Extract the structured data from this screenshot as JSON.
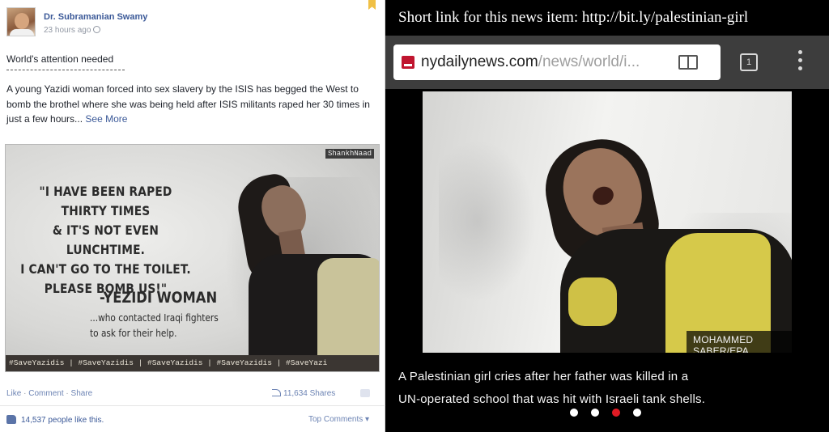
{
  "facebook_post": {
    "author": "Dr. Subramanian Swamy",
    "timestamp": "23 hours ago",
    "title": "World's attention needed",
    "body": "A young Yazidi woman forced into sex slavery by the ISIS has begged the West to bomb the brothel where she was being held after ISIS militants raped her 30 times in just a few hours...",
    "see_more": "See More",
    "poster": {
      "brand": "ShankhNaad",
      "quote_lines": [
        "\"I HAVE BEEN RAPED",
        "THIRTY TIMES",
        "& IT'S NOT EVEN LUNCHTIME.",
        "I CAN'T GO TO THE TOILET.",
        "PLEASE BOMB US!\""
      ],
      "attribution": "-YEZIDI WOMAN",
      "sub_lines": [
        "...who contacted Iraqi fighters",
        "to ask for their help."
      ],
      "hashtag_bar": "#SaveYazidis | #SaveYazidis | #SaveYazidis | #SaveYazidis | #SaveYazi"
    },
    "actions": {
      "like": "Like",
      "comment": "Comment",
      "share": "Share",
      "separator": "·"
    },
    "shares": "11,634 Shares",
    "likes": "14,537 people like this.",
    "top_comments": "Top Comments ▾",
    "icons": {
      "globe": "globe-icon",
      "bookmark": "bookmark-icon",
      "share": "share-icon",
      "comment": "comment-icon",
      "like": "thumbs-up-icon"
    },
    "colors": {
      "link": "#3b5998",
      "muted": "#9197a3"
    }
  },
  "nydailynews": {
    "short_link_text": "Short link for this news item: http://bit.ly/palestinian-girl",
    "browser": {
      "url_domain": "nydailynews.com",
      "url_path": "/news/world/i...",
      "tab_count": "1",
      "icons": {
        "site": "nydailynews-favicon",
        "reader": "reader-mode-icon",
        "tabs": "tab-switcher-icon",
        "menu": "overflow-menu-icon"
      }
    },
    "photo_credit": "MOHAMMED SABER/EPA",
    "caption_lines": [
      "A Palestinian girl cries after her father was killed in a",
      "UN-operated school that was hit with Israeli tank shells."
    ],
    "carousel": {
      "count": 4,
      "active_index": 2
    },
    "colors": {
      "accent": "#e01b24",
      "background": "#000000"
    }
  }
}
